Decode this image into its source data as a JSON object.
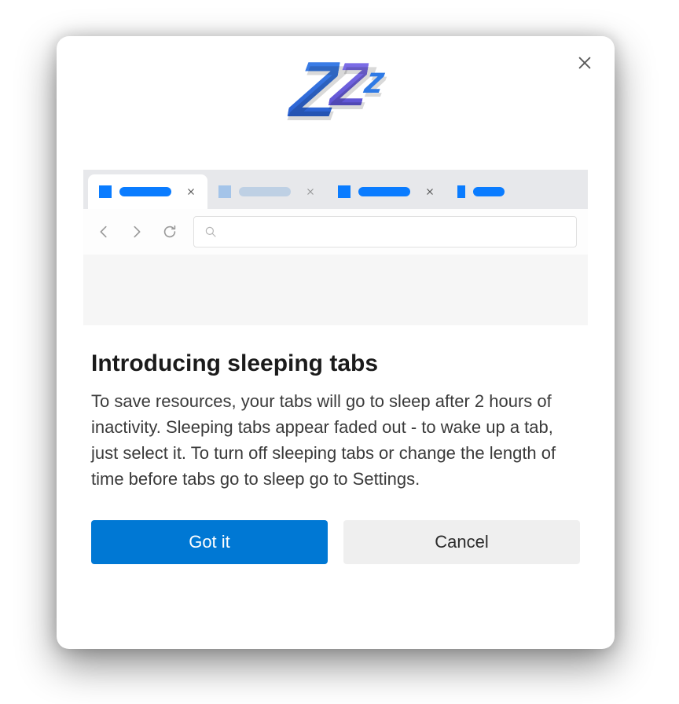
{
  "dialog": {
    "title": "Introducing sleeping tabs",
    "description": "To save resources, your tabs will go to sleep after 2 hours of inactivity. Sleeping tabs appear faded out - to wake up a tab, just select it. To turn off sleeping tabs or change the length of time before tabs go to sleep go to Settings.",
    "zzz_text": "Zzz"
  },
  "buttons": {
    "primary": "Got it",
    "secondary": "Cancel"
  },
  "icons": {
    "close": "close-icon",
    "back": "back-arrow-icon",
    "forward": "forward-arrow-icon",
    "refresh": "refresh-icon",
    "search": "search-icon"
  },
  "colors": {
    "accent": "#0078d4",
    "tab_active_highlight": "#0a7cff"
  }
}
